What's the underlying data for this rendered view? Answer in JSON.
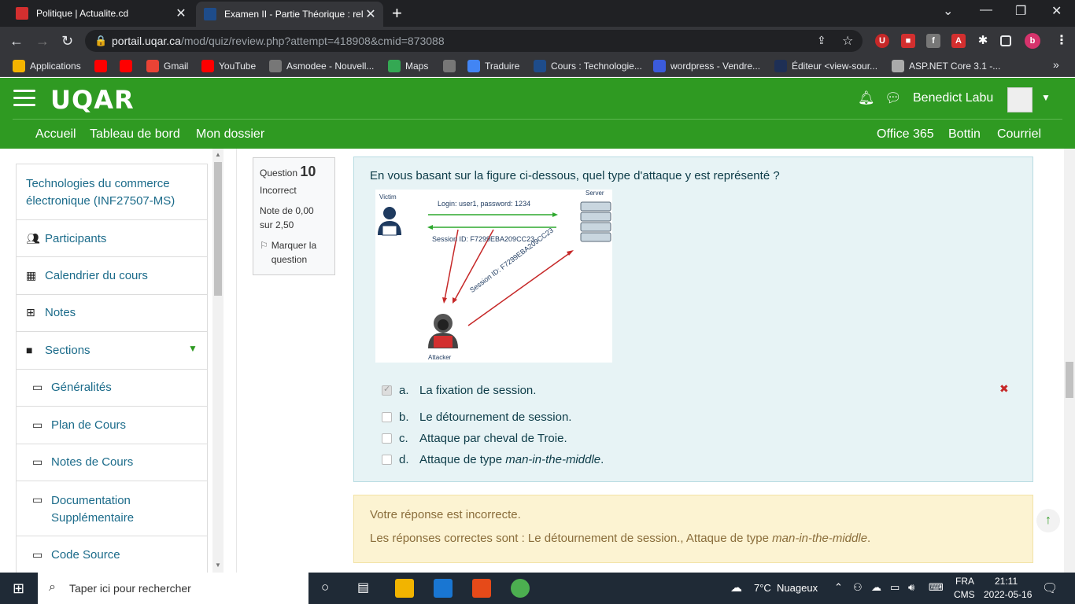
{
  "browser": {
    "tabs": [
      {
        "title": "Politique | Actualite.cd",
        "favicon_color": "#d32f2f"
      },
      {
        "title": "Examen II - Partie Théorique : rel",
        "favicon_color": "#1e4c8a"
      }
    ],
    "url_host": "portail.uqar.ca",
    "url_path": "/mod/quiz/review.php?attempt=418908&cmid=873088",
    "profile_letter": "b",
    "bookmarks": [
      {
        "label": "Applications",
        "color": "#f4b400"
      },
      {
        "label": "",
        "color": "#ff0000"
      },
      {
        "label": "",
        "color": "#ff0000"
      },
      {
        "label": "Gmail",
        "color": "#ea4335"
      },
      {
        "label": "YouTube",
        "color": "#ff0000"
      },
      {
        "label": "Asmodee - Nouvell...",
        "color": "#777777"
      },
      {
        "label": "Maps",
        "color": "#34a853"
      },
      {
        "label": "",
        "color": "#777777"
      },
      {
        "label": "Traduire",
        "color": "#4285f4"
      },
      {
        "label": "Cours : Technologie...",
        "color": "#1e4c8a"
      },
      {
        "label": "wordpress - Vendre...",
        "color": "#3b5bdb"
      },
      {
        "label": "Éditeur <view-sour...",
        "color": "#1e2f55"
      },
      {
        "label": "ASP.NET Core 3.1 -...",
        "color": "#aaaaaa"
      }
    ],
    "more": "»"
  },
  "site": {
    "logo": "UQAR",
    "username": "Benedict Labu",
    "nav_left": [
      "Accueil",
      "Tableau de bord",
      "Mon dossier"
    ],
    "nav_right": [
      "Office 365",
      "Bottin",
      "Courriel"
    ],
    "brand_color": "#2f9a22"
  },
  "sidebar": {
    "course": "Technologies du commerce électronique (INF27507-MS)",
    "items": [
      {
        "label": "Participants",
        "icon": "users-icon"
      },
      {
        "label": "Calendrier du cours",
        "icon": "calendar-icon"
      },
      {
        "label": "Notes",
        "icon": "table-icon"
      },
      {
        "label": "Sections",
        "icon": "folder-icon"
      }
    ],
    "sections": [
      "Généralités",
      "Plan de Cours",
      "Notes de Cours",
      "Documentation Supplémentaire",
      "Code Source"
    ]
  },
  "question": {
    "label": "Question",
    "number": "10",
    "status": "Incorrect",
    "grade": "Note de 0,00 sur 2,50",
    "flag": "Marquer la question",
    "text": "En vous basant sur la figure ci-dessous, quel type d'attaque y est représenté ?",
    "figure": {
      "victim": "Victim",
      "server": "Server",
      "attacker": "Attacker",
      "login": "Login: user1, password: 1234",
      "session": "Session ID: F7299EBA209CC23",
      "session_diag": "Session ID: F7299EBA209CC23"
    },
    "answers": [
      {
        "letter": "a.",
        "text": "La fixation de session.",
        "checked": true
      },
      {
        "letter": "b.",
        "text": "Le détournement de session.",
        "checked": false
      },
      {
        "letter": "c.",
        "text": "Attaque par cheval de Troie.",
        "checked": false
      },
      {
        "letter": "d.",
        "text": "Attaque de type ",
        "italic": "man-in-the-middle",
        "tail": ".",
        "checked": false
      }
    ],
    "wrong_mark": "✖"
  },
  "feedback": {
    "line1": "Votre réponse est incorrecte.",
    "line2": "Les réponses correctes sont : Le détournement de session., Attaque de type ",
    "line2_italic": "man-in-the-middle",
    "line2_tail": "."
  },
  "taskbar": {
    "search_placeholder": "Taper ici pour rechercher",
    "weather": "7°C  Nuageux",
    "lang1": "FRA",
    "lang2": "CMS",
    "time": "21:11",
    "date": "2022-05-16"
  }
}
